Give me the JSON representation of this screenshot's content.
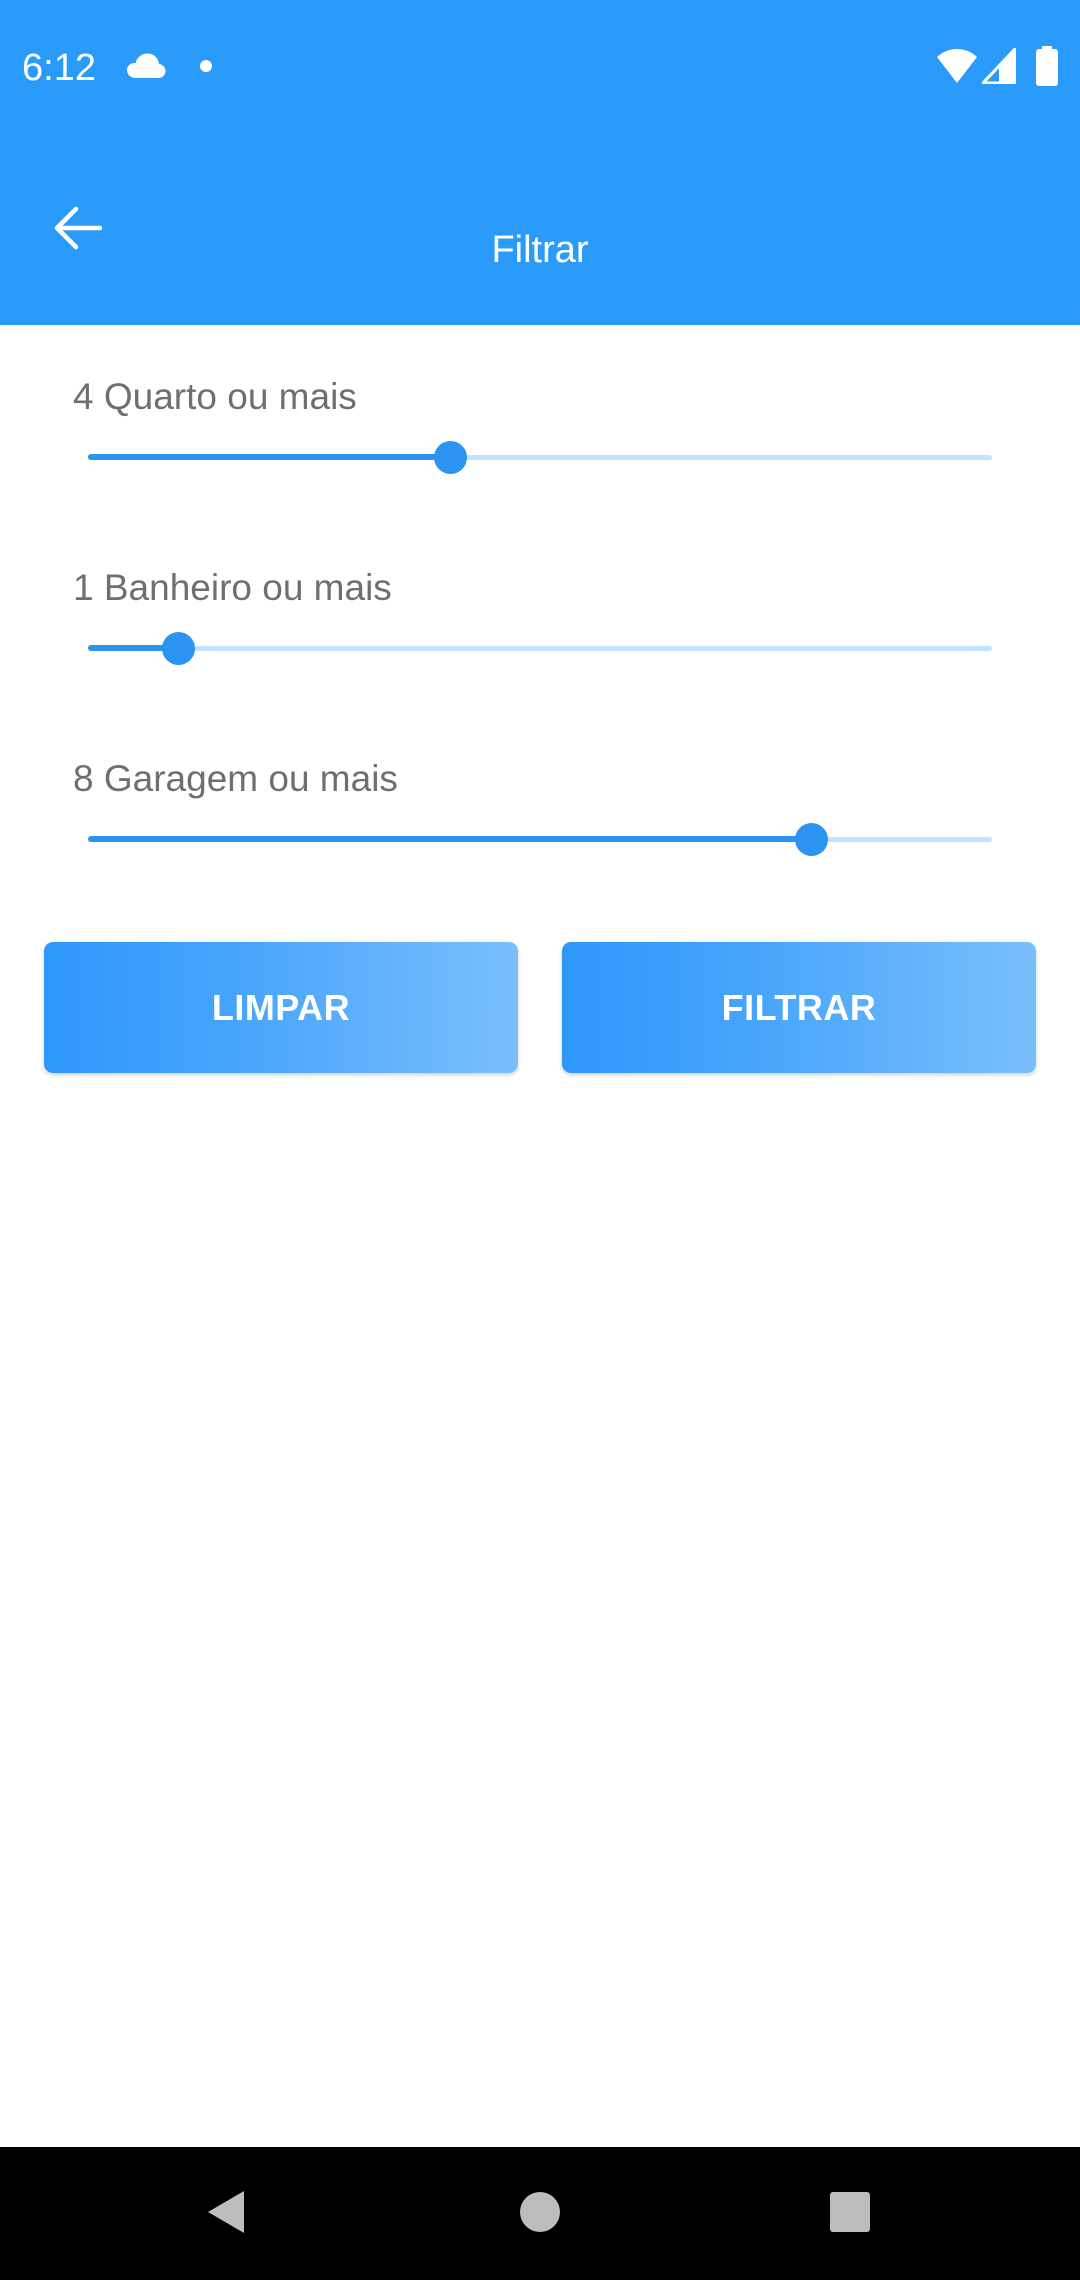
{
  "status_bar": {
    "time": "6:12",
    "icons": [
      "cloud-icon",
      "notification-dot-icon",
      "wifi-icon",
      "signal-icon",
      "battery-icon"
    ]
  },
  "app_bar": {
    "title": "Filtrar",
    "back_icon": "arrow-back-icon"
  },
  "filters": [
    {
      "label": "4 Quarto ou mais",
      "value_fraction": 0.4
    },
    {
      "label": "1 Banheiro ou mais",
      "value_fraction": 0.1
    },
    {
      "label": "8 Garagem ou mais",
      "value_fraction": 0.8
    }
  ],
  "actions": {
    "clear_label": "LIMPAR",
    "filter_label": "FILTRAR"
  },
  "nav_bar": {
    "icons": [
      "back-triangle-icon",
      "home-circle-icon",
      "recents-square-icon"
    ]
  },
  "colors": {
    "primary": "#2b9bfb",
    "slider_active": "#2b93f0",
    "slider_inactive": "#c4e1fd",
    "label_text": "#6f6f6f",
    "button_gradient_start": "#2d97fb",
    "button_gradient_end": "#79bffb"
  }
}
